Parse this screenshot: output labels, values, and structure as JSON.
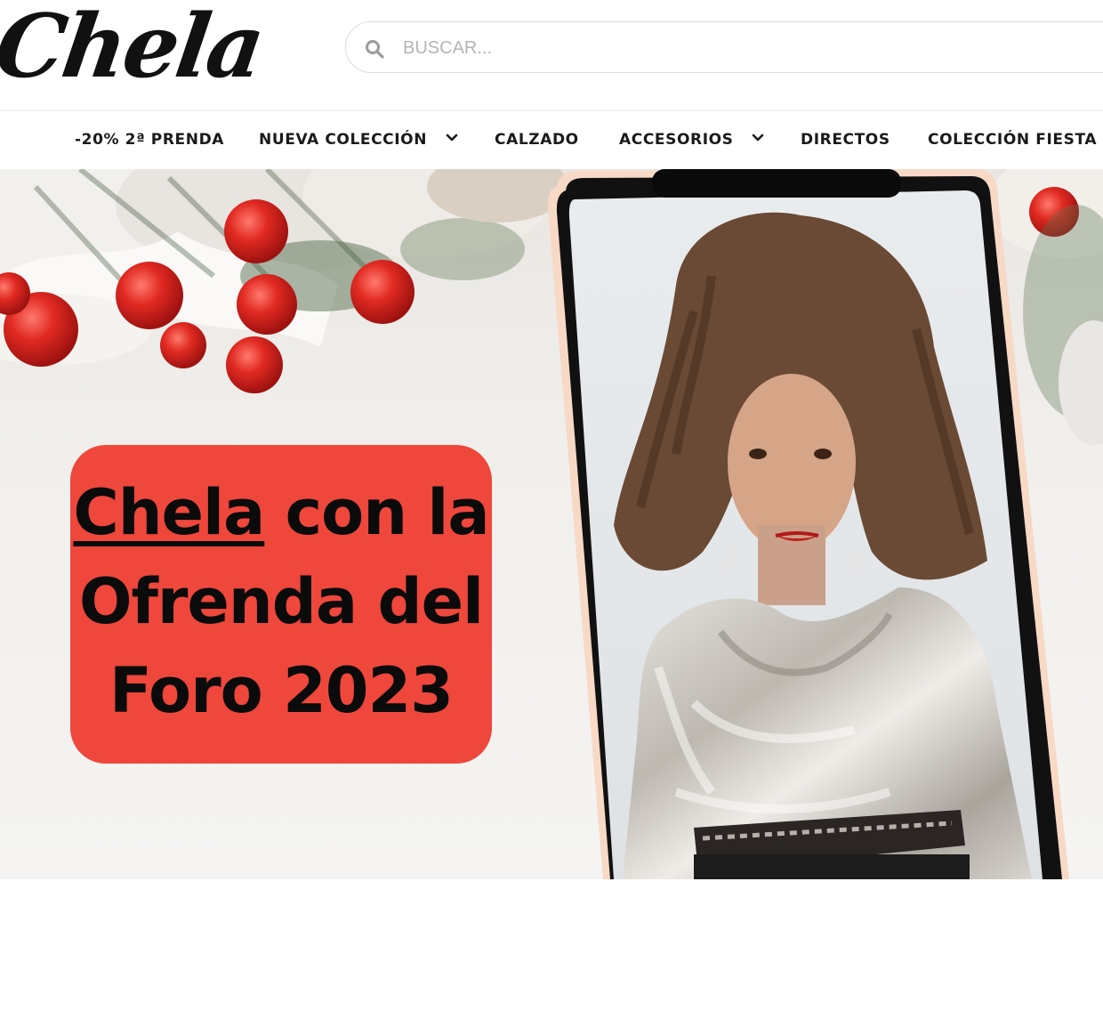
{
  "header": {
    "logo_text": "Chela",
    "search": {
      "placeholder": "BUSCAR...",
      "value": ""
    }
  },
  "nav": {
    "items": [
      {
        "label": "-20% 2ª PRENDA",
        "has_dropdown": false
      },
      {
        "label": "NUEVA COLECCIÓN",
        "has_dropdown": true
      },
      {
        "label": "CALZADO",
        "has_dropdown": false
      },
      {
        "label": "ACCESORIOS",
        "has_dropdown": true
      },
      {
        "label": "DIRECTOS",
        "has_dropdown": false
      },
      {
        "label": "COLECCIÓN FIESTA",
        "has_dropdown": false
      }
    ]
  },
  "hero": {
    "promo": {
      "brand_link": "Chela",
      "line1_rest": " con la",
      "line2": "Ofrenda del",
      "line3": "Foro 2023"
    },
    "colors": {
      "card": "#ef473c",
      "berries": "#d9201c",
      "phone_frame": "#111111",
      "blouse": "#c9c5bf"
    }
  },
  "icons": {
    "search": "search-icon",
    "dropdown": "chevron-down-icon"
  }
}
